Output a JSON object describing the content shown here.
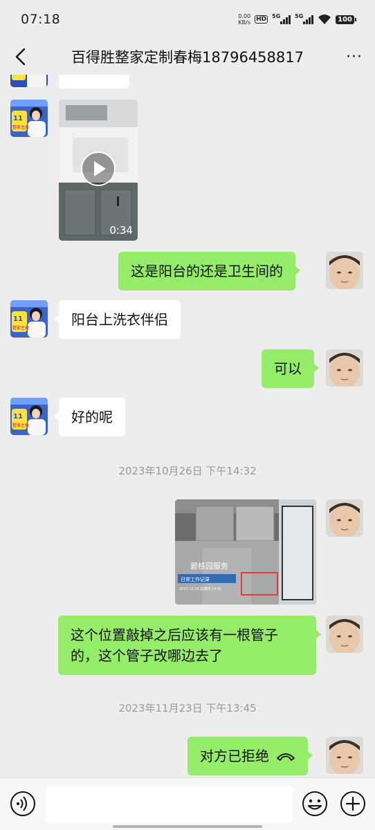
{
  "status_bar": {
    "time": "07:18",
    "net_speed_value": "0.00",
    "net_speed_unit": "KB/s",
    "hd_label": "HD",
    "sim1_label": "5G",
    "sim2_label": "5G",
    "battery": "100"
  },
  "header": {
    "back_icon": "chevron-left-icon",
    "title": "百得胜整家定制春梅18796458817",
    "more_label": "···"
  },
  "messages": [
    {
      "sender": "other",
      "type": "video",
      "duration": "0:34"
    },
    {
      "sender": "me",
      "type": "text",
      "text": "这是阳台的还是卫生间的"
    },
    {
      "sender": "other",
      "type": "text",
      "text": "阳台上洗衣伴侣"
    },
    {
      "sender": "me",
      "type": "text",
      "text": "可以"
    },
    {
      "sender": "other",
      "type": "text",
      "text": "好的呢"
    },
    {
      "type": "timestamp",
      "text": "2023年10月26日 下午14:32"
    },
    {
      "sender": "me",
      "type": "image",
      "overlay_brand": "碧桂园服务",
      "overlay_title": "日常工作记录",
      "overlay_time": "2023.10.26 星期四 14:31"
    },
    {
      "sender": "me",
      "type": "text",
      "line1": "这个位置敲掉之后应该有一根管子",
      "line2": "的，这个管子改哪边去了"
    },
    {
      "type": "timestamp",
      "text": "2023年11月23日 下午13:45"
    },
    {
      "sender": "me",
      "type": "call",
      "text": "对方已拒绝"
    }
  ],
  "avatar_other": {
    "badge_line1": "11",
    "badge_line2": "整家主播"
  },
  "input_bar": {
    "voice_icon": "voice-icon",
    "emoji_icon": "emoji-icon",
    "plus_icon": "plus-icon",
    "placeholder": ""
  },
  "colors": {
    "background": "#ededed",
    "bubble_out": "#95ec69",
    "bubble_in": "#ffffff",
    "timestamp": "#9a9a9a"
  }
}
